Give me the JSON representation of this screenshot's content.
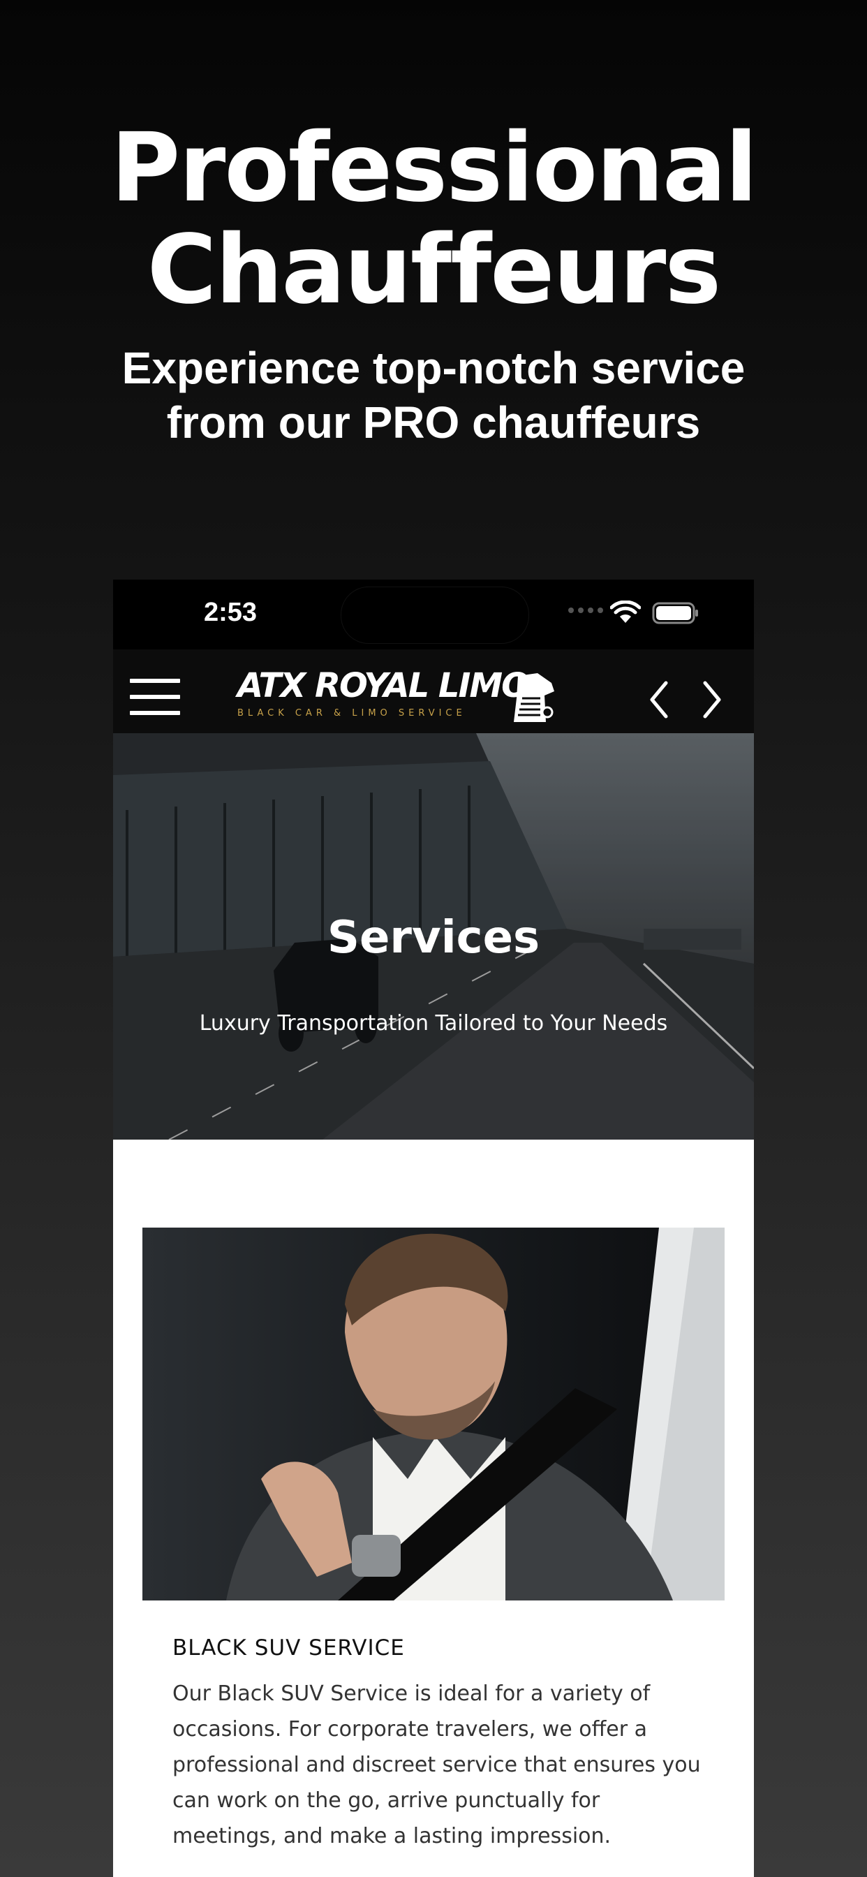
{
  "promo": {
    "headline_line1": "Professional",
    "headline_line2": "Chauffeurs",
    "subhead_line1": "Experience top-notch service",
    "subhead_line2": "from our PRO chauffeurs"
  },
  "status_bar": {
    "time": "2:53",
    "wifi_icon": "wifi-icon",
    "battery_icon": "battery-icon"
  },
  "navbar": {
    "menu_icon": "hamburger-menu-icon",
    "logo_text": "ATX ROYAL LIMO",
    "logo_subtext": "BLACK CAR & LIMO SERVICE",
    "back_icon": "chevron-left-icon",
    "forward_icon": "chevron-right-icon"
  },
  "hero": {
    "title": "Services",
    "tagline": "Luxury Transportation Tailored to Your Needs"
  },
  "service": {
    "title": "BLACK SUV SERVICE",
    "description": "Our Black SUV Service is ideal for a variety of occasions. For corporate travelers, we offer a professional and discreet service that ensures you can work on the go, arrive punctually for meetings, and make a lasting impression."
  },
  "colors": {
    "accent_gold": "#c8a24a",
    "background_dark": "#0c0c0c",
    "content_bg": "#ffffff"
  }
}
